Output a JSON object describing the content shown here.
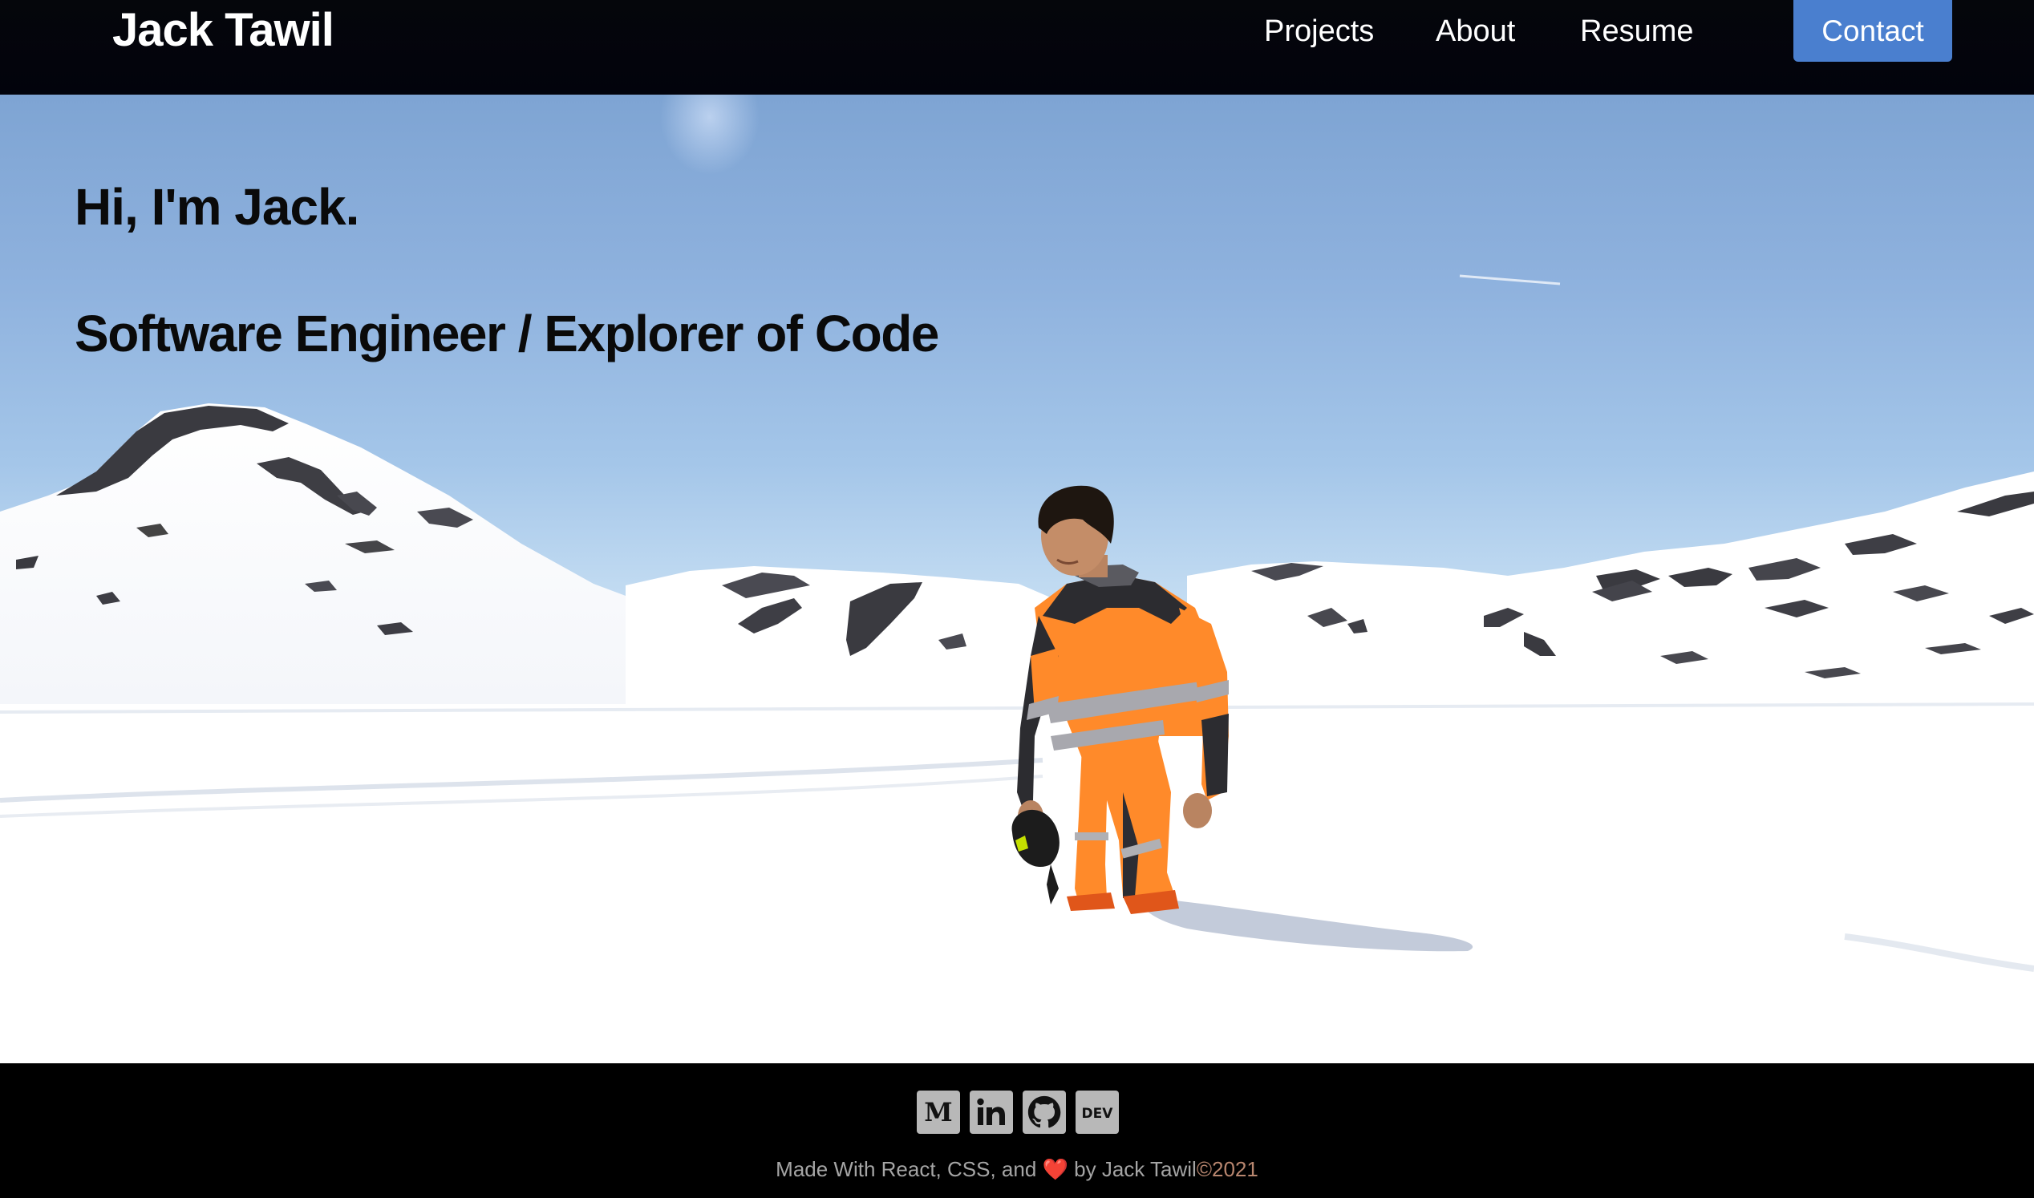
{
  "nav": {
    "brand": "Jack Tawil",
    "links": [
      "Projects",
      "About",
      "Resume"
    ],
    "contact_label": "Contact"
  },
  "hero": {
    "title": "Hi, I'm Jack.",
    "subtitle": "Software Engineer / Explorer of Code"
  },
  "footer": {
    "social": [
      "medium-icon",
      "linkedin-icon",
      "github-icon",
      "dev-icon"
    ],
    "dev_label": "DEV",
    "credit_prefix": "Made With React, CSS, and",
    "heart": "❤️",
    "credit_suffix": "by Jack Tawil",
    "year": "©2021"
  },
  "colors": {
    "nav_bg": "#03040c",
    "contact_bg": "#4a7fcf",
    "footer_bg": "#000000",
    "footer_text": "#a5a5a5",
    "year_text": "#b8866f",
    "suit_orange": "#ff8a2a"
  }
}
